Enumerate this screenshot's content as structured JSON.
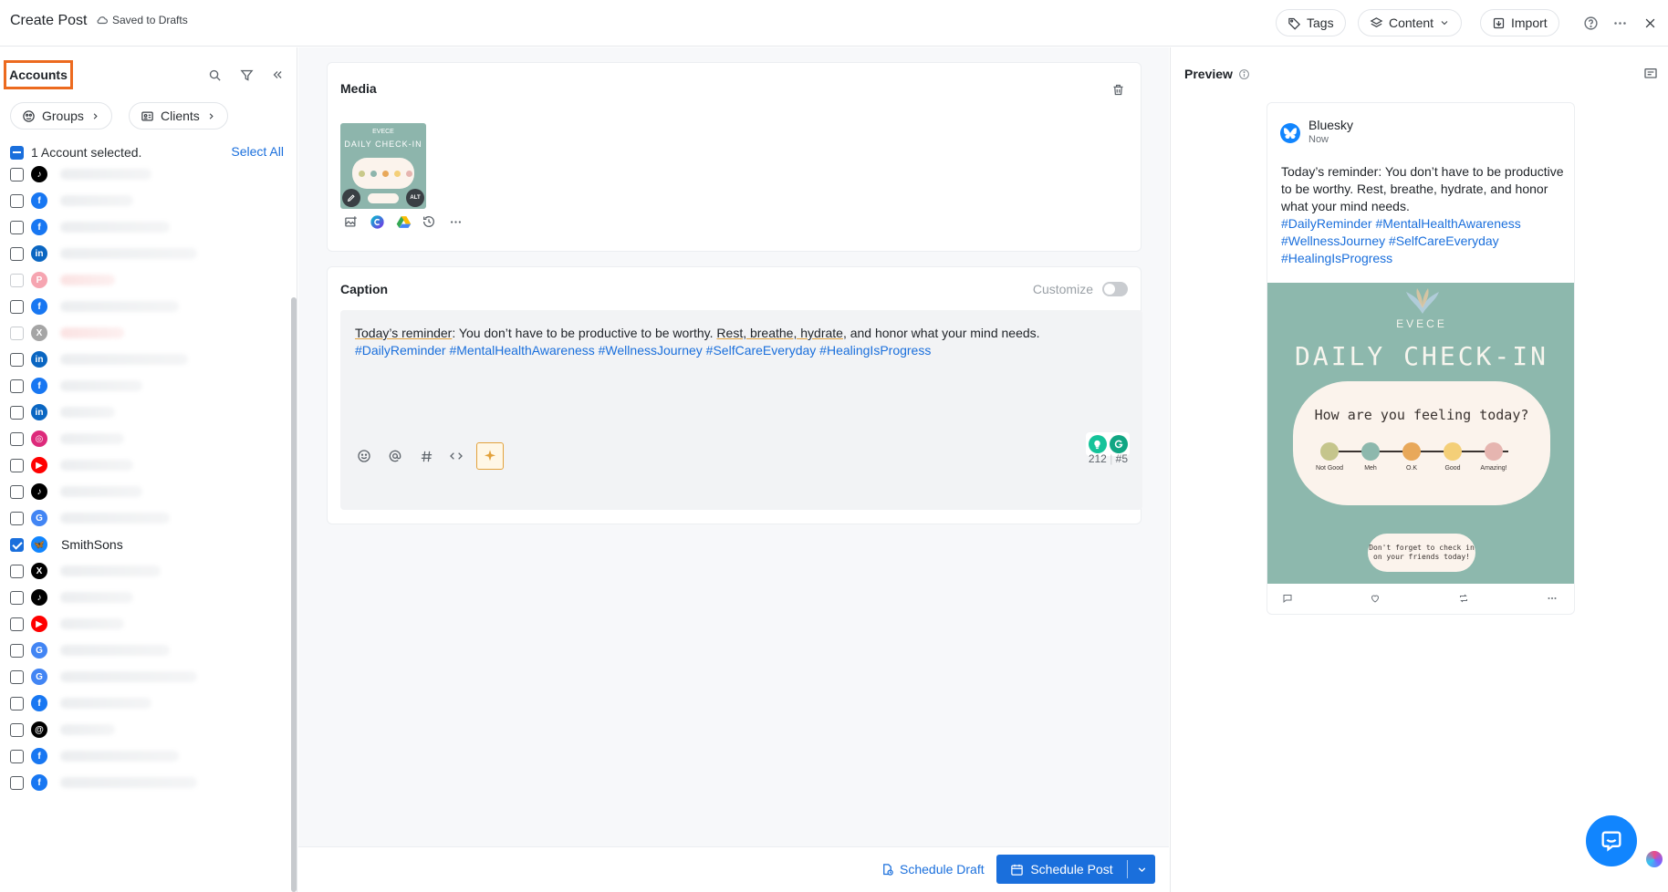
{
  "header": {
    "title": "Create Post",
    "saved_status": "Saved to Drafts",
    "tags_label": "Tags",
    "content_label": "Content",
    "import_label": "Import"
  },
  "accounts_panel": {
    "title": "Accounts",
    "groups_label": "Groups",
    "clients_label": "Clients",
    "selected_text": "1 Account selected.",
    "select_all_label": "Select All",
    "accounts": [
      {
        "network": "tiktok",
        "name": "",
        "checked": false,
        "disabled": false
      },
      {
        "network": "facebook",
        "name": "",
        "checked": false,
        "disabled": false
      },
      {
        "network": "facebook",
        "name": "",
        "checked": false,
        "disabled": false
      },
      {
        "network": "linkedin",
        "name": "",
        "checked": false,
        "disabled": false
      },
      {
        "network": "pinterest",
        "name": "",
        "checked": false,
        "disabled": true
      },
      {
        "network": "facebook",
        "name": "",
        "checked": false,
        "disabled": false
      },
      {
        "network": "x",
        "name": "",
        "checked": false,
        "disabled": true
      },
      {
        "network": "linkedin",
        "name": "",
        "checked": false,
        "disabled": false
      },
      {
        "network": "facebook",
        "name": "",
        "checked": false,
        "disabled": false
      },
      {
        "network": "linkedin",
        "name": "",
        "checked": false,
        "disabled": false
      },
      {
        "network": "instagram",
        "name": "",
        "checked": false,
        "disabled": false
      },
      {
        "network": "youtube",
        "name": "",
        "checked": false,
        "disabled": false
      },
      {
        "network": "tiktok",
        "name": "",
        "checked": false,
        "disabled": false
      },
      {
        "network": "google-business",
        "name": "",
        "checked": false,
        "disabled": false
      },
      {
        "network": "bluesky",
        "name": "SmithSons",
        "checked": true,
        "disabled": false
      },
      {
        "network": "x",
        "name": "",
        "checked": false,
        "disabled": false
      },
      {
        "network": "tiktok",
        "name": "",
        "checked": false,
        "disabled": false
      },
      {
        "network": "youtube",
        "name": "",
        "checked": false,
        "disabled": false
      },
      {
        "network": "google-business",
        "name": "",
        "checked": false,
        "disabled": false
      },
      {
        "network": "google-business",
        "name": "",
        "checked": false,
        "disabled": false
      },
      {
        "network": "facebook",
        "name": "",
        "checked": false,
        "disabled": false
      },
      {
        "network": "threads",
        "name": "",
        "checked": false,
        "disabled": false
      },
      {
        "network": "facebook",
        "name": "",
        "checked": false,
        "disabled": false
      },
      {
        "network": "facebook",
        "name": "",
        "checked": false,
        "disabled": false
      }
    ]
  },
  "media": {
    "title": "Media",
    "alt_badge": "ALT",
    "image_texts": {
      "brand": "EVECE",
      "heading": "DAILY CHECK-IN",
      "question": "How are you feeling today?",
      "moods": [
        "Not Good",
        "Meh",
        "O.K",
        "Good",
        "Amazing!"
      ],
      "reminder_line1": "Don't forget to check in",
      "reminder_line2": "on your friends today!"
    }
  },
  "caption": {
    "title": "Caption",
    "customize_label": "Customize",
    "text_part1": "Today’s reminder",
    "text_part2": ": You don’t have to be productive to be worthy. ",
    "text_part3": "Rest, breathe, hydrate",
    "text_part4": ", and honor what your mind needs.",
    "hashtags": "#DailyReminder #MentalHealthAwareness #WellnessJourney #SelfCareEveryday #HealingIsProgress",
    "char_count": "212",
    "hashtag_count": "#5"
  },
  "footer": {
    "schedule_draft_label": "Schedule Draft",
    "schedule_post_label": "Schedule Post"
  },
  "preview": {
    "title": "Preview",
    "network_name": "Bluesky",
    "time": "Now",
    "text": "Today’s reminder: You don’t have to be productive to be worthy. Rest, breathe, hydrate, and honor what your mind needs.",
    "hashtag_lines": [
      "#DailyReminder #MentalHealthAwareness",
      "#WellnessJourney #SelfCareEveryday",
      "#HealingIsProgress"
    ]
  },
  "colors": {
    "accent": "#1a6fdc",
    "highlight_border": "#ec6a1f",
    "bluesky": "#1185fe"
  }
}
